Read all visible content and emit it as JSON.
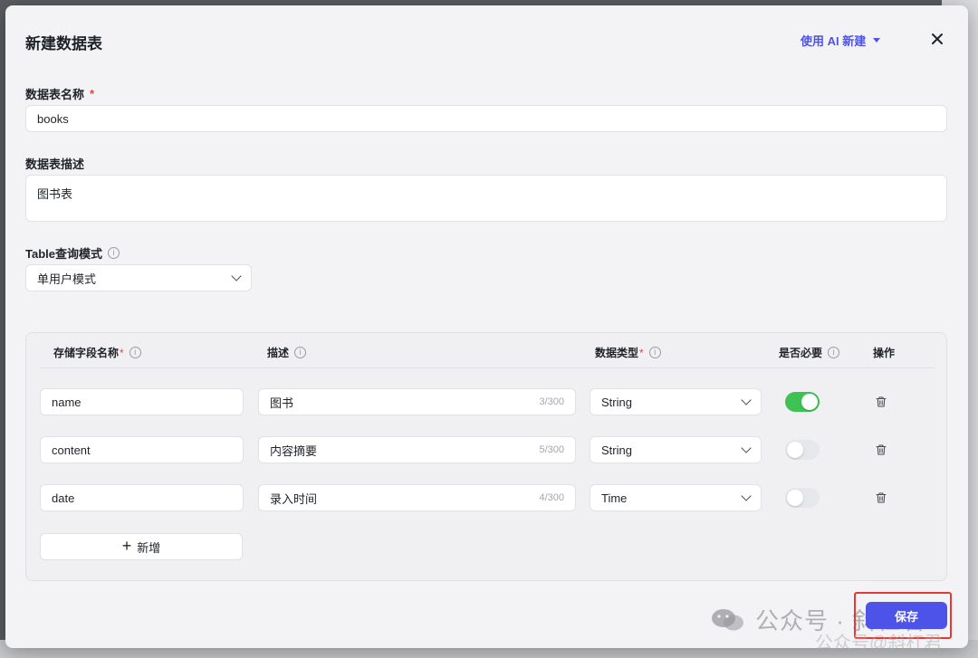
{
  "modal": {
    "title": "新建数据表",
    "ai_create_label": "使用 AI 新建"
  },
  "form": {
    "name": {
      "label": "数据表名称",
      "required_mark": "*",
      "value": "books"
    },
    "description": {
      "label": "数据表描述",
      "value": "图书表"
    },
    "query_mode": {
      "label": "Table查询模式",
      "value": "单用户模式"
    }
  },
  "fields_table": {
    "headers": {
      "name": "存储字段名称",
      "desc": "描述",
      "type": "数据类型",
      "required": "是否必要",
      "actions": "操作"
    },
    "required_mark": "*",
    "rows": [
      {
        "name": "name",
        "desc": "图书",
        "counter": "3/300",
        "type": "String",
        "required": true
      },
      {
        "name": "content",
        "desc": "内容摘要",
        "counter": "5/300",
        "type": "String",
        "required": false
      },
      {
        "name": "date",
        "desc": "录入时间",
        "counter": "4/300",
        "type": "Time",
        "required": false
      }
    ],
    "add_label": "新增"
  },
  "footer": {
    "save_label": "保存",
    "watermark_text": "公众号 · 斜杠君",
    "watermark_small": "公众号@斜杠君"
  },
  "colors": {
    "accent": "#4d53e8",
    "toggle_on": "#3ec254",
    "required": "#e0463a",
    "highlight": "#e53935"
  }
}
